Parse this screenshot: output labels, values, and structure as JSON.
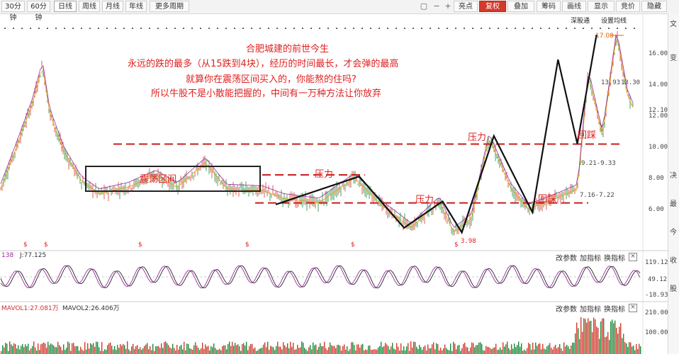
{
  "toolbar": {
    "buttons": [
      "30分钟",
      "60分钟",
      "日线",
      "周线",
      "月线",
      "年线",
      "更多周期"
    ],
    "right_buttons": [
      "亮点",
      "复权",
      "叠加",
      "筹码",
      "画线",
      "显示",
      "竞价",
      "隐藏"
    ],
    "icons": [
      "bag-icon",
      "zoom-out-icon",
      "zoom-in-icon",
      "left-icon"
    ],
    "active": "日线",
    "highlight": "复权"
  },
  "sub_header": {
    "left": "深股通",
    "right": "设置均线"
  },
  "annotations": {
    "title": "合肥城建的前世今生",
    "line1": "永远的跌的最多（从15跌到4块），经历的时间最长，才会弹的最高",
    "line2": "就算你在震荡区间买入的，你能熬的住吗?",
    "line3": "所以牛股不是小散能把握的，中间有一万种方法让你放弃",
    "zone": "震荡区间",
    "pressure1": "压力",
    "pressure2": "压力",
    "pressure3": "压力",
    "pullback1": "回踩",
    "pullback2": "回踩"
  },
  "price_labels": {
    "high": "17.08",
    "mid": "13.93",
    "mid2": "13.30",
    "range1": "9.21-9.33",
    "range2": "7.16-7.22",
    "low": "3.98"
  },
  "macd_header": {
    "left": "138",
    "j": "J:77.125"
  },
  "vol_header": {
    "mavol1": "MAVOL1:27.081万",
    "mavol2": "MAVOL2:26.406万"
  },
  "panel_buttons": [
    "改参数",
    "加指标",
    "换指标"
  ],
  "dividend_mark": "$",
  "chart_data": {
    "type": "line",
    "title": "合肥城建的前世今生",
    "y_ticks": [
      "16.00",
      "14.00",
      "12.10",
      "12.00",
      "10.00",
      "8.00",
      "6.00"
    ],
    "ind_ticks": [
      "119.12",
      "49.12",
      "-18.93"
    ],
    "vol_ticks": [
      "210.00",
      "100.00"
    ],
    "key_prices": {
      "low": 3.98,
      "high": 17.08,
      "last": 12.1
    },
    "trend_line": [
      {
        "x": 0.43,
        "y": 6.1
      },
      {
        "x": 0.56,
        "y": 7.9
      },
      {
        "x": 0.63,
        "y": 4.6
      },
      {
        "x": 0.69,
        "y": 6.3
      },
      {
        "x": 0.72,
        "y": 4.3
      },
      {
        "x": 0.77,
        "y": 10.5
      },
      {
        "x": 0.83,
        "y": 5.6
      },
      {
        "x": 0.87,
        "y": 15.4
      },
      {
        "x": 0.9,
        "y": 10.0
      },
      {
        "x": 0.93,
        "y": 17.0
      }
    ],
    "pressure_levels": [
      10.0,
      8.0,
      6.2
    ]
  }
}
